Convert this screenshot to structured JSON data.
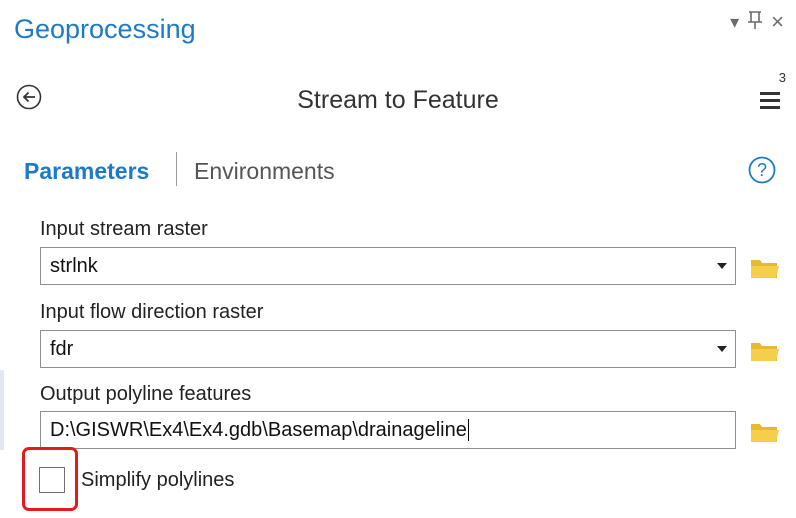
{
  "pane": {
    "title": "Geoprocessing",
    "controls": {
      "dropdown": "▾",
      "pin": "Ҏ",
      "close": "×"
    }
  },
  "tool": {
    "title": "Stream to Feature",
    "menu_badge": "3"
  },
  "tabs": [
    {
      "label": "Parameters",
      "active": true
    },
    {
      "label": "Environments",
      "active": false
    }
  ],
  "params": [
    {
      "label": "Input stream raster",
      "value": "strlnk",
      "type": "dropdown"
    },
    {
      "label": "Input flow direction raster",
      "value": "fdr",
      "type": "dropdown"
    },
    {
      "label": "Output polyline features",
      "value": "D:\\GISWR\\Ex4\\Ex4.gdb\\Basemap\\drainageline",
      "type": "text"
    }
  ],
  "checkbox": {
    "label": "Simplify polylines",
    "checked": false
  },
  "colors": {
    "accent": "#1c7ac9",
    "highlight": "#e8191c",
    "folder": "#e8b830"
  },
  "icons": [
    "back-arrow-icon",
    "hamburger-menu-icon",
    "help-icon",
    "folder-icon"
  ]
}
